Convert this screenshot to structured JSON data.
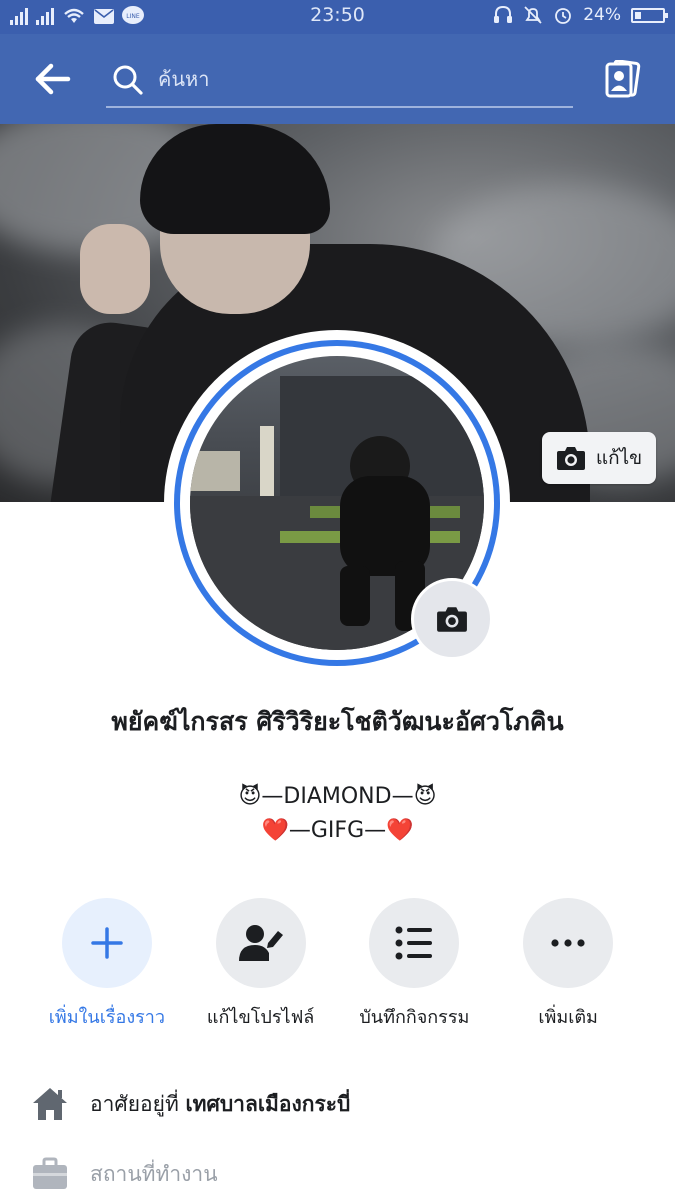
{
  "status_bar": {
    "time": "23:50",
    "battery_percent": "24%",
    "battery_level": 0.24,
    "icons": [
      "signal-icon",
      "signal-icon",
      "wifi-icon",
      "mail-icon",
      "line-app-icon",
      "headset-icon",
      "mute-icon",
      "alarm-icon",
      "battery-icon"
    ]
  },
  "topbar": {
    "search_placeholder": "ค้นหา",
    "icons": [
      "back-arrow-icon",
      "search-icon",
      "contacts-icon"
    ]
  },
  "cover": {
    "edit_label": "แก้ไข"
  },
  "profile": {
    "name": "พยัคฆ์ไกรสร ศิริวิริยะโชติวัฒนะอัศวโภคิน",
    "bio_line1": "😈—DIAMOND—😈",
    "bio_line2": "❤️—GIFG—❤️"
  },
  "actions": [
    {
      "label": "เพิ่มในเรื่องราว",
      "icon": "plus-icon"
    },
    {
      "label": "แก้ไขโปรไฟล์",
      "icon": "edit-profile-icon"
    },
    {
      "label": "บันทึกกิจกรรม",
      "icon": "list-icon"
    },
    {
      "label": "เพิ่มเติม",
      "icon": "more-icon"
    }
  ],
  "info": {
    "lives_in_prefix": "อาศัยอยู่ที่",
    "lives_in_place": "เทศบาลเมืองกระบี่",
    "workplace": "สถานที่ทำงาน"
  },
  "colors": {
    "header_blue": "#4267b2",
    "status_blue": "#3b5fae",
    "accent_blue": "#3578e5"
  }
}
